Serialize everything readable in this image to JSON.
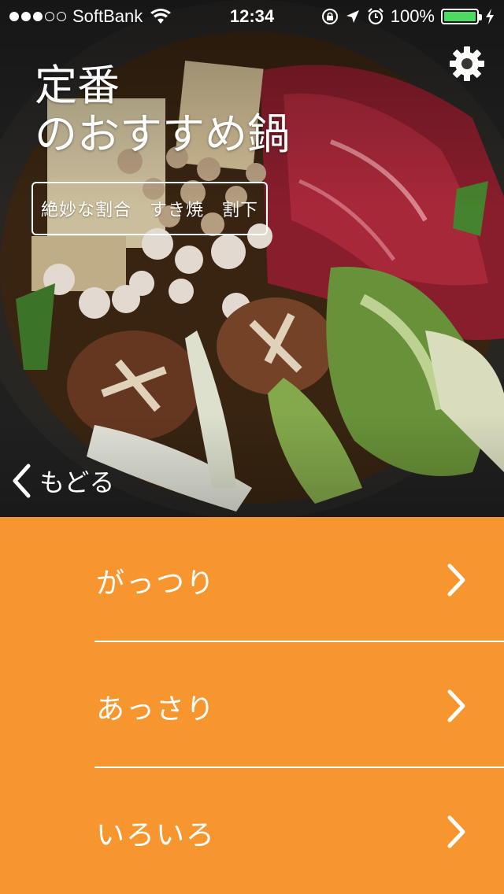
{
  "status_bar": {
    "signal_dots_filled": 3,
    "signal_dots_total": 5,
    "carrier": "SoftBank",
    "time": "12:34",
    "battery": "100%",
    "battery_color": "#4cd964",
    "icons": [
      "wifi-icon",
      "rotation-lock-icon",
      "location-icon",
      "alarm-icon",
      "battery-icon",
      "charging-icon"
    ]
  },
  "header": {
    "title_line1": "定番",
    "title_line2": "のおすすめ鍋",
    "badge": "絶妙な割合　すき焼　割下",
    "settings_icon": "gear-icon"
  },
  "nav": {
    "back_label": "もどる"
  },
  "menu": {
    "accent_color": "#f7962f",
    "items": [
      {
        "label": "がっつり"
      },
      {
        "label": "あっさり"
      },
      {
        "label": "いろいろ"
      }
    ]
  }
}
